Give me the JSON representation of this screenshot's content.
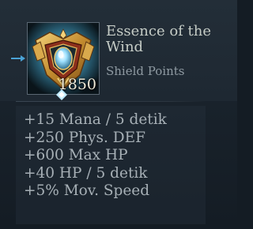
{
  "item": {
    "name": "Essence of the Wind",
    "type": "Shield Points",
    "shield_value": "1850",
    "icon": "golden-shield-emblem-icon"
  },
  "stats": [
    "+15 Mana / 5 detik",
    "+250 Phys. DEF",
    "+600 Max HP",
    "+40 HP / 5 detik",
    "+5% Mov. Speed"
  ],
  "colors": {
    "background": "#1d2731",
    "name_text": "#c5ccc6",
    "type_text": "#8f9aa2",
    "stat_text": "#a7b0b6",
    "gold": "#c99a3c",
    "gem_blue": "#7fd6ff"
  }
}
